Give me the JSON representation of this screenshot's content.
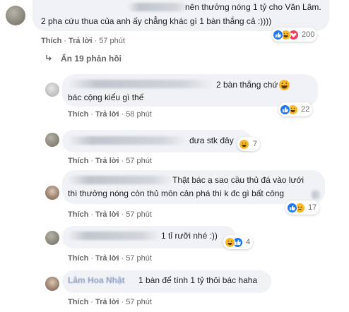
{
  "top_comment": {
    "line1": "nên thưởng nóng 1 tỷ cho Văn Lâm.",
    "line2": "2 pha cứu thua của anh ấy chẳng khác gì 1 bàn thắng cả :))))",
    "like_label": "Thích",
    "reply_label": "Trả lời",
    "time": "57 phút",
    "reaction_count": "200"
  },
  "hide_replies_label": "Ẩn 19 phản hồi",
  "replies": [
    {
      "line1": "2 bàn thắng chứ",
      "line2": "bác cộng kiểu gì thế",
      "like_label": "Thích",
      "reply_label": "Trả lời",
      "time": "58 phút",
      "reaction_count": "22"
    },
    {
      "line1": "đưa stk đây",
      "like_label": "Thích",
      "reply_label": "Trả lời",
      "time": "57 phút",
      "reaction_count": "7"
    },
    {
      "line1": "Thật bác ạ sao cầu thủ đá vào lưới",
      "line2": "thì thưởng nóng còn thủ môn cản phá thì k đc gì bất công",
      "like_label": "Thích",
      "reply_label": "Trả lời",
      "time": "57 phút",
      "reaction_count": "17"
    },
    {
      "line1": "1 tỉ rưỡi nhé :))",
      "like_label": "Thích",
      "reply_label": "Trả lời",
      "time": "57 phút",
      "reaction_count": "4"
    },
    {
      "author_partial": "Lâm Hoa Nhật",
      "line1": "1 bàn để tính 1 tỷ thôi bác haha",
      "like_label": "Thích",
      "reply_label": "Trả lời",
      "time": "57 phút"
    }
  ],
  "colors": {
    "like": "#1877f2",
    "haha": "#f7b928",
    "love": "#f33e58",
    "bubble": "#f0f2f5",
    "meta": "#65676b"
  },
  "icons": [
    "like-icon",
    "haha-icon",
    "love-icon",
    "sad-icon",
    "reply-arrow-icon"
  ]
}
